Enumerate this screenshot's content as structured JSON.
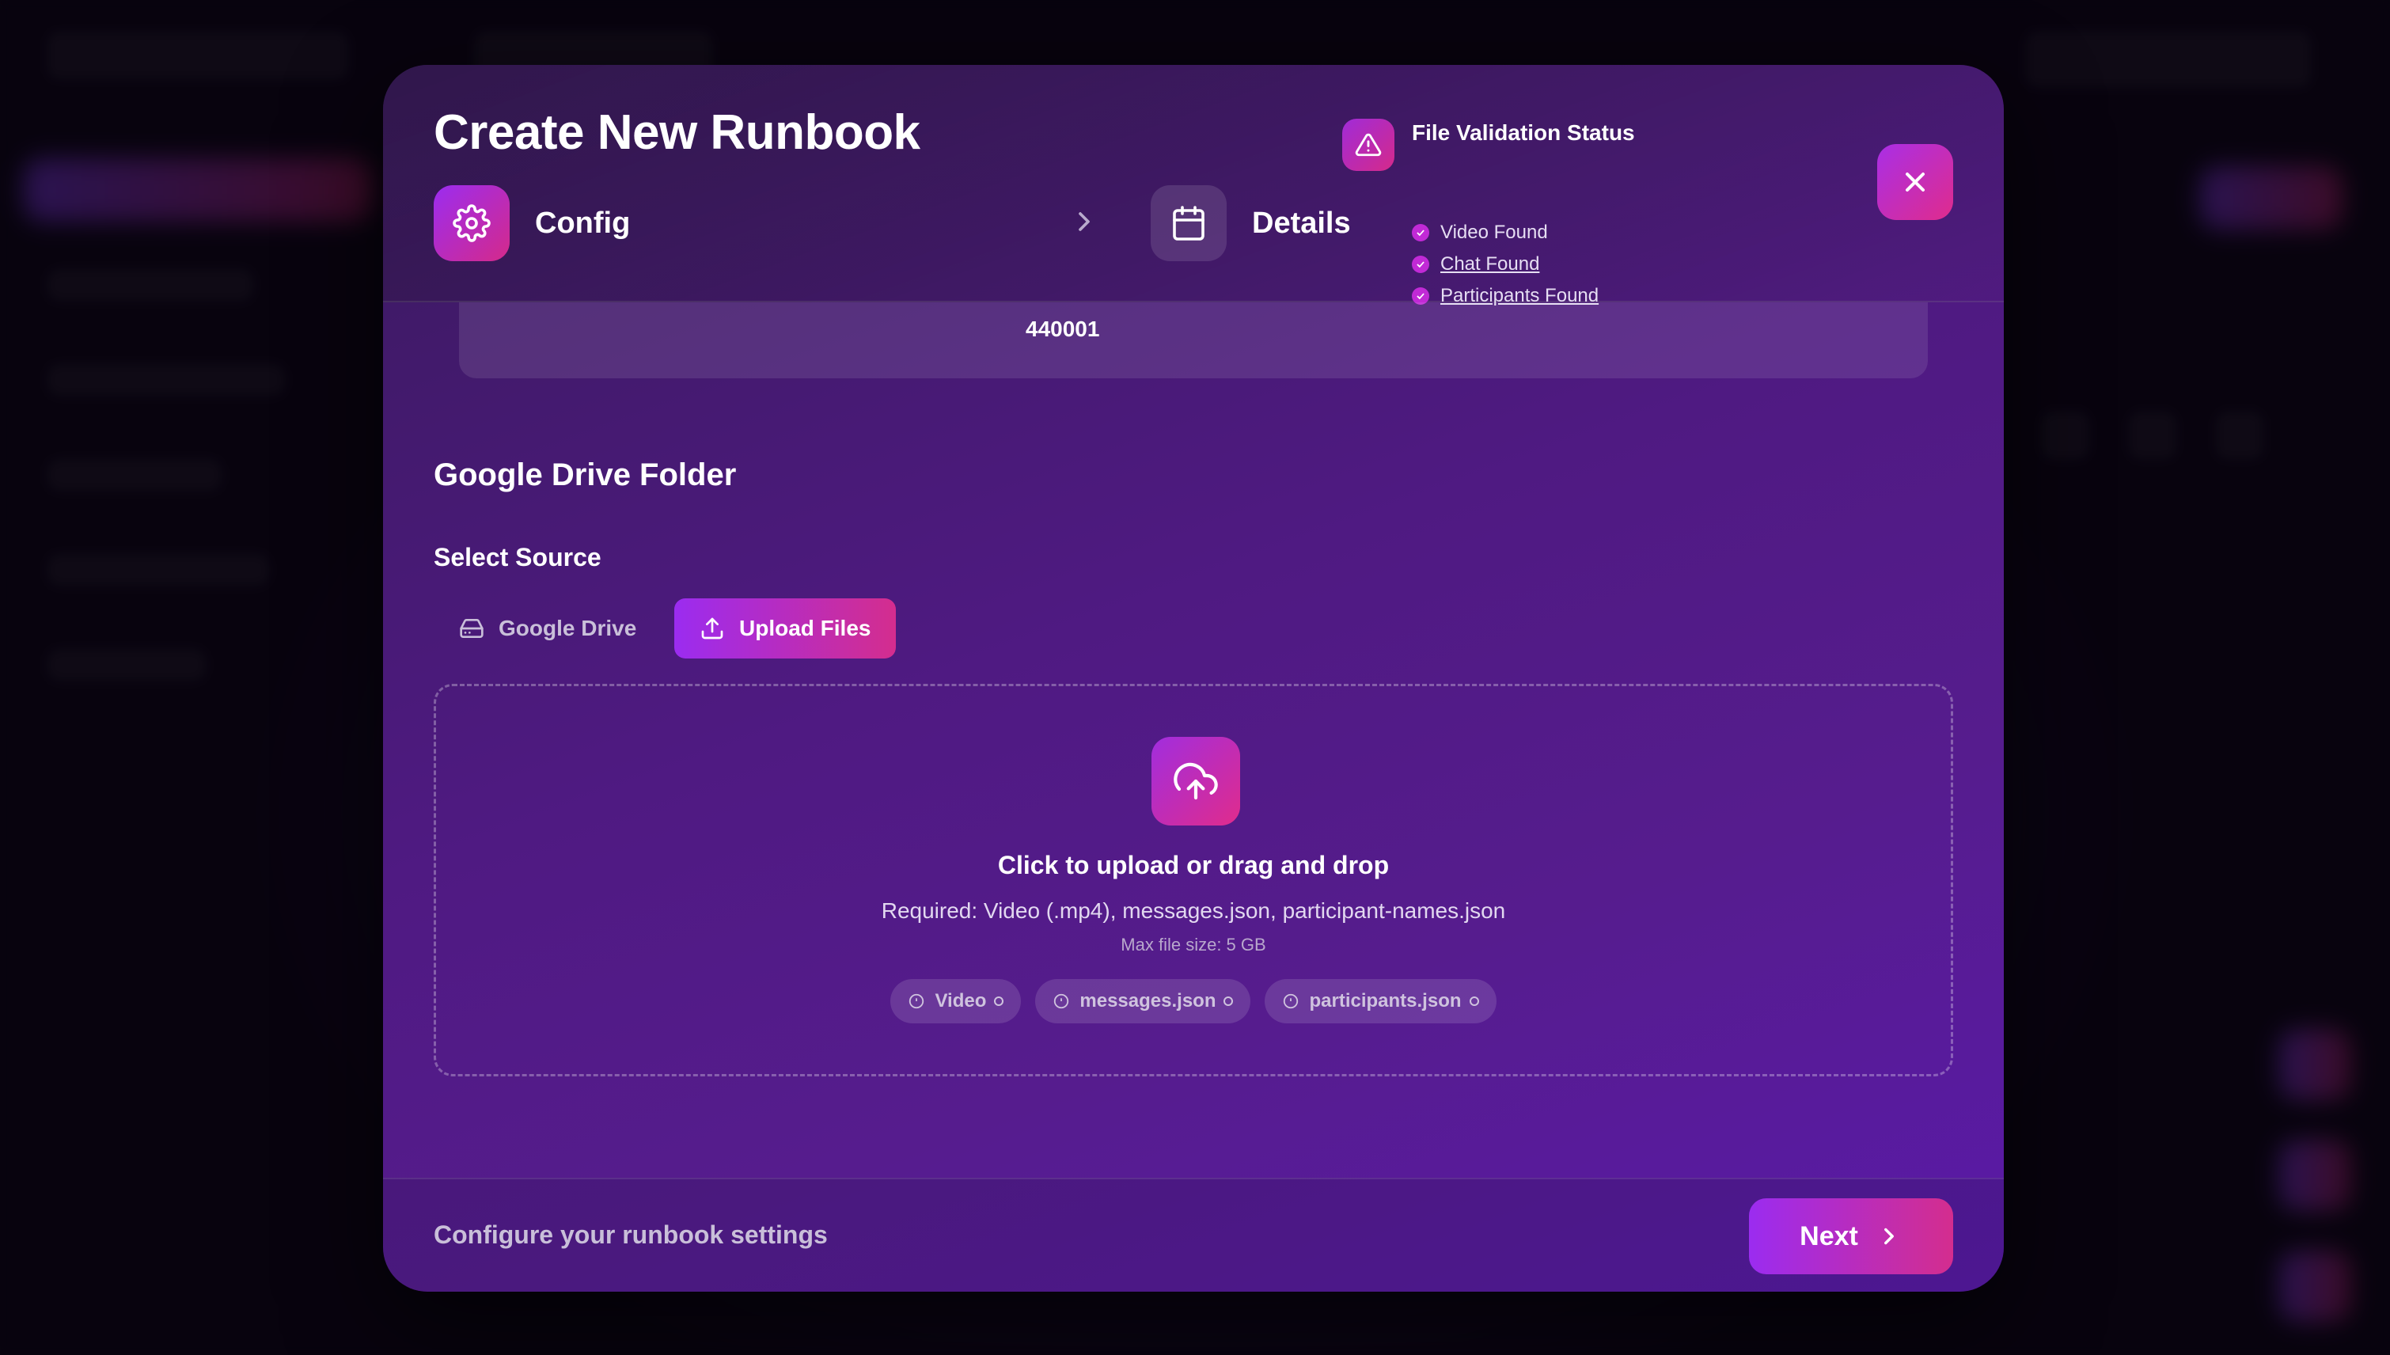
{
  "modal": {
    "title": "Create New Runbook",
    "steps": [
      {
        "label": "Config",
        "icon": "gear-icon",
        "active": true
      },
      {
        "label": "Details",
        "icon": "calendar-icon",
        "active": false
      }
    ]
  },
  "validation": {
    "title": "File Validation Status",
    "items": [
      {
        "label": "Video Found",
        "link": false
      },
      {
        "label": "Chat Found",
        "link": true
      },
      {
        "label": "Participants Found",
        "link": true
      }
    ]
  },
  "info_card": {
    "value": "440001"
  },
  "section": {
    "title": "Google Drive Folder",
    "select_source_label": "Select Source",
    "tabs": [
      {
        "label": "Google Drive",
        "icon": "drive-icon",
        "active": false
      },
      {
        "label": "Upload Files",
        "icon": "upload-icon",
        "active": true
      }
    ]
  },
  "dropzone": {
    "title": "Click to upload or drag and drop",
    "required": "Required: Video (.mp4), messages.json, participant-names.json",
    "max_size": "Max file size: 5 GB",
    "chips": [
      "Video",
      "messages.json",
      "participants.json"
    ]
  },
  "footer": {
    "text": "Configure your runbook settings",
    "next_label": "Next"
  },
  "colors": {
    "accent_start": "#9b2cf0",
    "accent_end": "#d42d8e",
    "modal_bg": "#4f1a82"
  }
}
